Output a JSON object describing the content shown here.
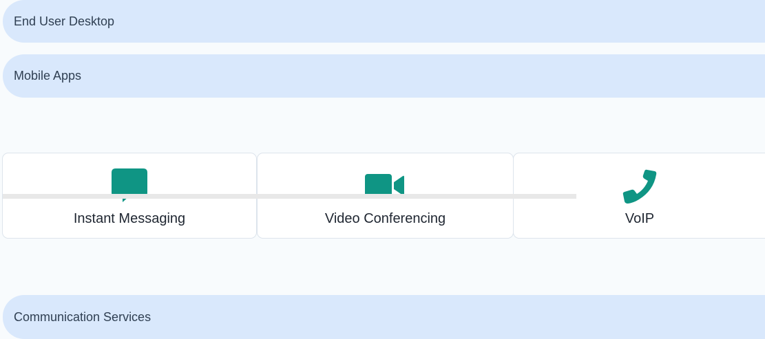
{
  "layers": {
    "end_user_desktop": "End User Desktop",
    "mobile_apps": "Mobile Apps",
    "communication_services": "Communication Services"
  },
  "cards": [
    {
      "label": "Instant Messaging",
      "icon": "chat-bubble-icon"
    },
    {
      "label": "Video Conferencing",
      "icon": "video-camera-icon"
    },
    {
      "label": "VoIP",
      "icon": "phone-icon"
    }
  ],
  "colors": {
    "accent": "#0f9584",
    "bar_fill": "#d9e8fc",
    "background": "#f8fbfd",
    "card_border": "#dde4ec",
    "connector": "#e8e8e8"
  }
}
